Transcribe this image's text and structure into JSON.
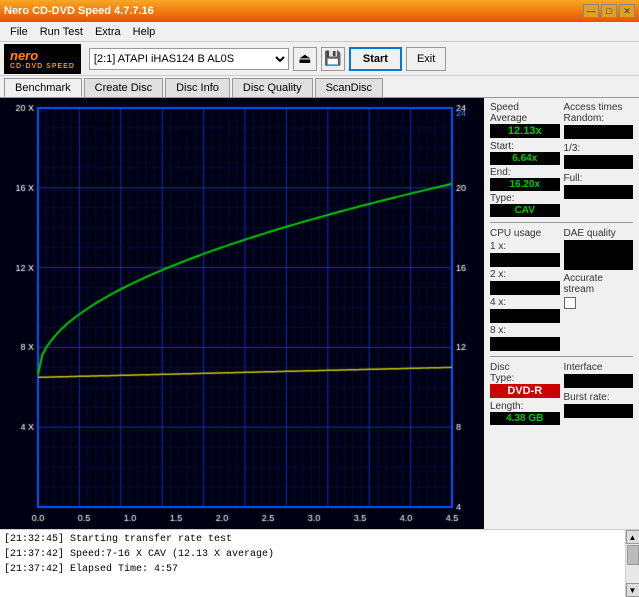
{
  "window": {
    "title": "Nero CD-DVD Speed 4.7.7.16",
    "controls": {
      "minimize": "—",
      "maximize": "□",
      "close": "✕"
    }
  },
  "menu": {
    "items": [
      "File",
      "Run Test",
      "Extra",
      "Help"
    ]
  },
  "toolbar": {
    "logo_main": "nero",
    "logo_sub": "CD·DVD SPEED",
    "drive_label": "[2:1]  ATAPI iHAS124  B AL0S",
    "start_label": "Start",
    "exit_label": "Exit"
  },
  "tabs": [
    {
      "id": "benchmark",
      "label": "Benchmark",
      "active": true
    },
    {
      "id": "create-disc",
      "label": "Create Disc",
      "active": false
    },
    {
      "id": "disc-info",
      "label": "Disc Info",
      "active": false
    },
    {
      "id": "disc-quality",
      "label": "Disc Quality",
      "active": false
    },
    {
      "id": "scandisk",
      "label": "ScanDisc",
      "active": false
    }
  ],
  "chart": {
    "x_labels": [
      "0.0",
      "0.5",
      "1.0",
      "1.5",
      "2.0",
      "2.5",
      "3.0",
      "3.5",
      "4.0",
      "4.5"
    ],
    "y_left_labels": [
      "4 X",
      "8 X",
      "12 X",
      "16 X",
      "20 X"
    ],
    "y_right_labels": [
      "4",
      "8",
      "12",
      "16",
      "20",
      "24"
    ]
  },
  "speed_panel": {
    "title": "Speed",
    "average_label": "Average",
    "average_value": "12.13x",
    "start_label": "Start:",
    "start_value": "6.64x",
    "end_label": "End:",
    "end_value": "16.20x",
    "type_label": "Type:",
    "type_value": "CAV"
  },
  "access_panel": {
    "title": "Access times",
    "random_label": "Random:",
    "one_third_label": "1/3:",
    "full_label": "Full:"
  },
  "cpu_panel": {
    "title": "CPU usage",
    "labels": [
      "1 x:",
      "2 x:",
      "4 x:",
      "8 x:"
    ]
  },
  "dae_panel": {
    "title": "DAE quality",
    "accurate_label": "Accurate",
    "stream_label": "stream"
  },
  "disc_panel": {
    "title": "Disc",
    "type_label": "Type:",
    "type_value": "DVD-R",
    "length_label": "Length:",
    "length_value": "4.38 GB"
  },
  "interface_panel": {
    "title": "Interface",
    "burst_label": "Burst rate:"
  },
  "log": {
    "entries": [
      "[21:32:45]  Starting transfer rate test",
      "[21:37:42]  Speed:7-16 X CAV (12.13 X average)",
      "[21:37:42]  Elapsed Time: 4:57"
    ]
  }
}
